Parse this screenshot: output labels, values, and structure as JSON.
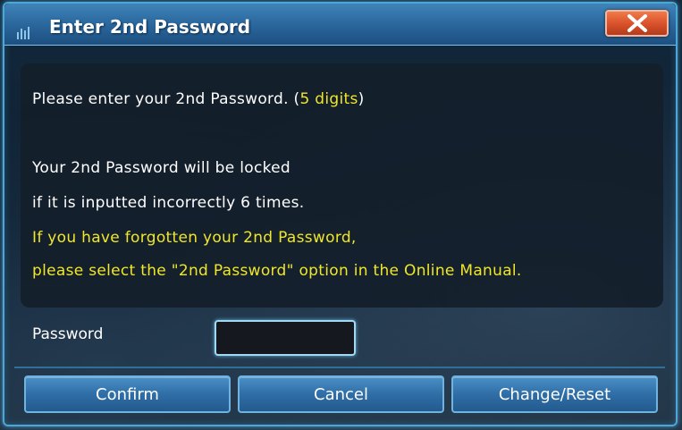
{
  "dialog": {
    "title": "Enter 2nd Password",
    "close_icon": "close-x-icon"
  },
  "message": {
    "line1_prefix": "Please enter your 2nd Password. (",
    "line1_highlight": "5 digits",
    "line1_suffix": ")",
    "line2": "Your 2nd Password will be locked",
    "line3": "if it is inputted incorrectly 6 times.",
    "line4": "If you have forgotten your 2nd Password,",
    "line5": "please select the \"2nd Password\" option in the Online Manual."
  },
  "password": {
    "label": "Password",
    "value": "",
    "placeholder": ""
  },
  "buttons": {
    "confirm": "Confirm",
    "cancel": "Cancel",
    "change_reset": "Change/Reset"
  },
  "colors": {
    "highlight": "#f0e62a",
    "title_bar": "#2c6aa0",
    "close_button": "#d8502a",
    "button": "#2f6ea6"
  }
}
